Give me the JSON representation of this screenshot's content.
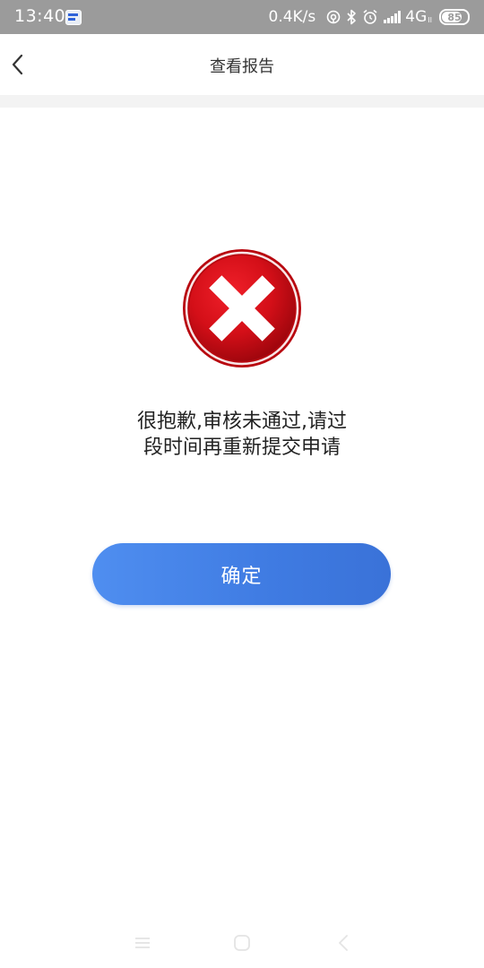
{
  "status_bar": {
    "time": "13:40",
    "net_speed": "0.4K/s",
    "network": "4G",
    "network_sub": "II",
    "battery": "85",
    "battery_level": 0.85
  },
  "header": {
    "title": "查看报告"
  },
  "result": {
    "icon": "error-x-icon",
    "message_line1": "很抱歉,审核未通过,请过",
    "message_line2": "段时间再重新提交申请"
  },
  "actions": {
    "confirm_label": "确定"
  },
  "colors": {
    "status_bar_bg": "#9b9b9b",
    "accent_blue": "#4a86ea",
    "error_red": "#d8111b",
    "separator": "#f3f3f3"
  }
}
